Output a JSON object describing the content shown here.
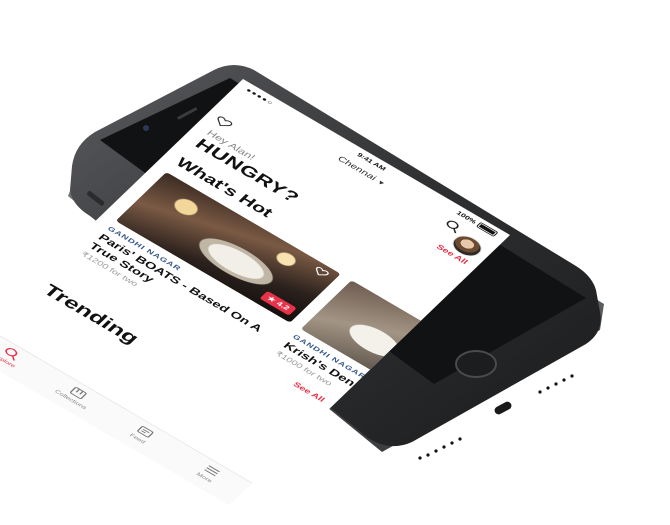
{
  "status_bar": {
    "signal": "●●●●○",
    "time": "9:41 AM",
    "battery": "100%"
  },
  "header": {
    "city": "Chennai",
    "search_icon": "search-icon",
    "avatar_icon": "avatar"
  },
  "greeting": {
    "hey": "Hey Alan!",
    "hungry": "HUNGRY?"
  },
  "links": {
    "see_all_top": "See All",
    "see_all_bottom": "See All"
  },
  "sections": {
    "whats_hot": "What's Hot",
    "trending": "Trending"
  },
  "cards": [
    {
      "locality": "GANDHI NAGAR",
      "name": "Paris' BOATS - Based On A True Story",
      "cost": "₹1200 for two",
      "rating": "★ 4.2"
    },
    {
      "locality": "GANDHI NAGAR",
      "name": "Krish's Den Lake View",
      "cost": "₹1000 for two"
    }
  ],
  "tabs": [
    {
      "label": "Explore",
      "icon": "search-icon"
    },
    {
      "label": "Collections",
      "icon": "collections-icon"
    },
    {
      "label": "Feed",
      "icon": "feed-icon"
    },
    {
      "label": "More",
      "icon": "menu-icon"
    }
  ],
  "colors": {
    "accent": "#e8324a",
    "locality": "#3b5b8c",
    "phone_body": "#3a3b3d"
  }
}
